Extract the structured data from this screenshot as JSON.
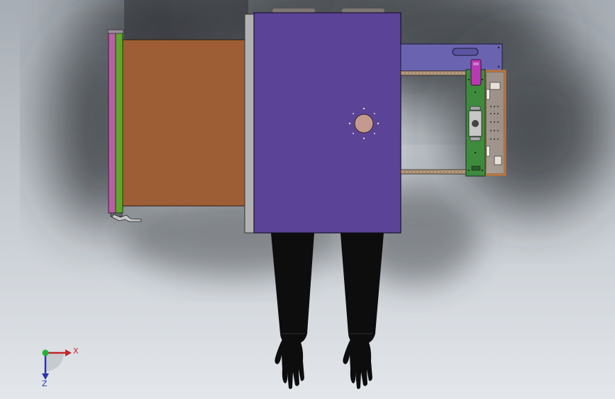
{
  "viewport": {
    "background_top": "#a7adb4",
    "background_bottom": "#e3e7ec"
  },
  "triad": {
    "x_label": "X",
    "z_label": "Z",
    "x_color": "#c0282d",
    "y_color": "#23b33b",
    "z_color": "#2a37a8"
  },
  "colors": {
    "body_panel": "#5b4397",
    "drawer": "#9e5e35",
    "front_plate": "#b1b1b1",
    "green_bar": "#5fa72b",
    "pink_bar": "#b85fa6",
    "side_plate": "#6a64b0",
    "circuit_board": "#3f8b3e",
    "orange_frame": "#c0763c",
    "magenta_part": "#b83ab3",
    "porthole": "#c49a8e",
    "gloves": "#0d0d0d"
  }
}
